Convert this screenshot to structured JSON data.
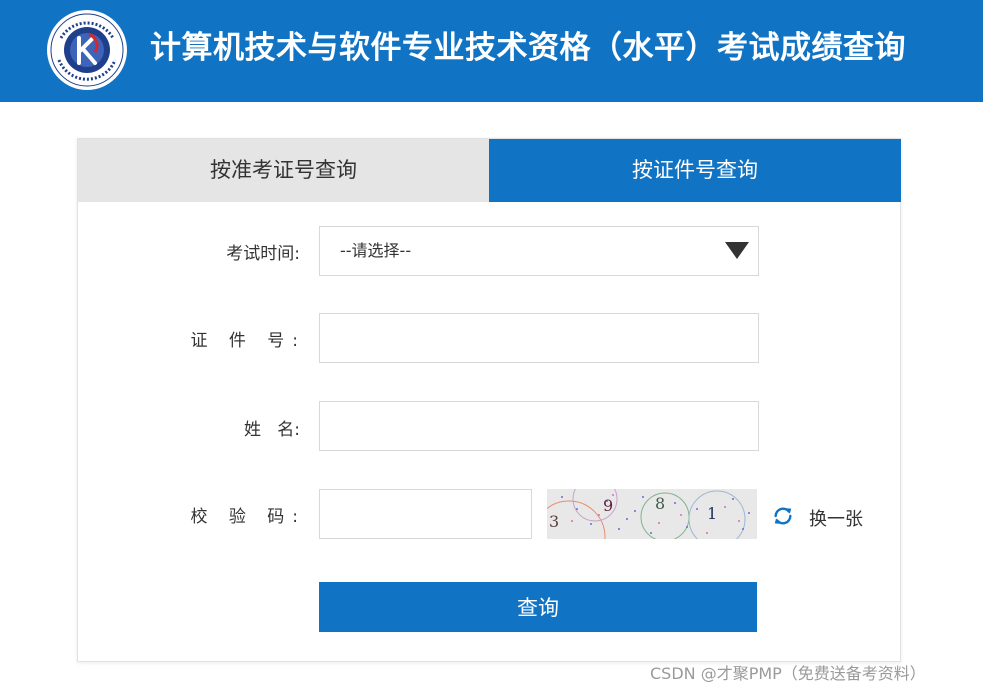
{
  "header": {
    "title": "计算机技术与软件专业技术资格（水平）考试成绩查询",
    "logo_icon": "ruankao-emblem-logo"
  },
  "tabs": [
    {
      "label": "按准考证号查询",
      "active": false
    },
    {
      "label": "按证件号查询",
      "active": true
    }
  ],
  "form": {
    "exam_time": {
      "label": "考试时间:",
      "selected": "--请选择--"
    },
    "id_number": {
      "label": "证 件 号:",
      "value": ""
    },
    "name": {
      "label": "姓   名:",
      "value": ""
    },
    "captcha": {
      "label": "校 验 码:",
      "value": "",
      "image_digits": [
        "3",
        "9",
        "8",
        "1"
      ],
      "refresh_label": "换一张"
    },
    "submit_label": "查询"
  },
  "watermark": "CSDN @才聚PMP（免费送备考资料）",
  "colors": {
    "primary": "#1173c3",
    "tab_inactive": "#e5e5e5"
  }
}
